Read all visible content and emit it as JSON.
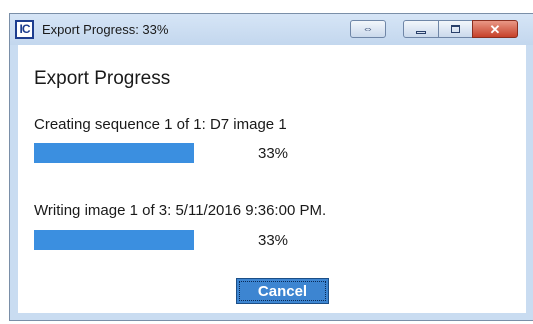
{
  "window": {
    "title": "Export Progress: 33%",
    "app_icon_text": "IC"
  },
  "dialog": {
    "heading": "Export Progress",
    "tasks": [
      {
        "label": "Creating sequence 1 of 1: D7 image 1",
        "progress": 0.33,
        "percent_text": "33%"
      },
      {
        "label": "Writing image 1 of 3: 5/11/2016 9:36:00 PM.",
        "progress": 0.33,
        "percent_text": "33%"
      }
    ],
    "cancel_label": "Cancel"
  },
  "colors": {
    "progress_fill": "#3b8fe0",
    "cancel_button": "#3d85d1",
    "title_bar": "#c9dcf1"
  }
}
